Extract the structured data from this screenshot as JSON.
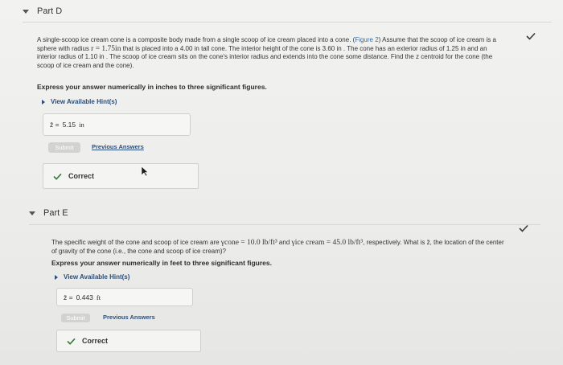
{
  "partD": {
    "title": "Part D",
    "problem": {
      "line1a": "A single-scoop ice cream cone is a composite body made from a single scoop of ice cream placed into a cone. (",
      "figure_link": "Figure 2",
      "line1b": ") Assume that the scoop of ice cream is a",
      "line2a": "sphere with radius ",
      "r_expr": "r = 1.75in",
      "line2b": " that is placed into a 4.00 in tall cone. The interior height of the cone is 3.60 in . The cone has an exterior radius of 1.25 in and an",
      "line3": "interior radius of 1.10 in . The scoop of ice cream sits on the cone's interior radius and extends into the cone some distance. Find the z centroid for the cone (the",
      "line4": "scoop of ice cream and the cone)."
    },
    "instruction": "Express your answer numerically in inches to three significant figures.",
    "hints_label": "View Available Hint(s)",
    "answer": {
      "var": "z̄ =",
      "value": "5.15",
      "unit": "in"
    },
    "submit_label": "Submit",
    "previous_label": "Previous Answers",
    "correct_label": "Correct"
  },
  "partE": {
    "title": "Part E",
    "problem": {
      "line1a": "The specific weight of the cone and scoop of ice cream are ",
      "gamma_cone": "γcone = 10.0 lb/ft³",
      "and": " and ",
      "gamma_ice": "γice cream = 45.0 lb/ft³",
      "line1b": ", respectively. What is z̄, the location of the center",
      "line2": "of gravity of the cone (i.e., the cone and scoop of ice cream)?"
    },
    "instruction": "Express your answer numerically in feet to three significant figures.",
    "hints_label": "View Available Hint(s)",
    "answer": {
      "var": "z̄ =",
      "value": "0.443",
      "unit": "ft"
    },
    "submit_label": "Submit",
    "previous_label": "Previous Answers",
    "correct_label": "Correct"
  },
  "colors": {
    "check": "#3a7a3a",
    "link": "#2a6fb0",
    "hint": "#2b4f7a"
  }
}
